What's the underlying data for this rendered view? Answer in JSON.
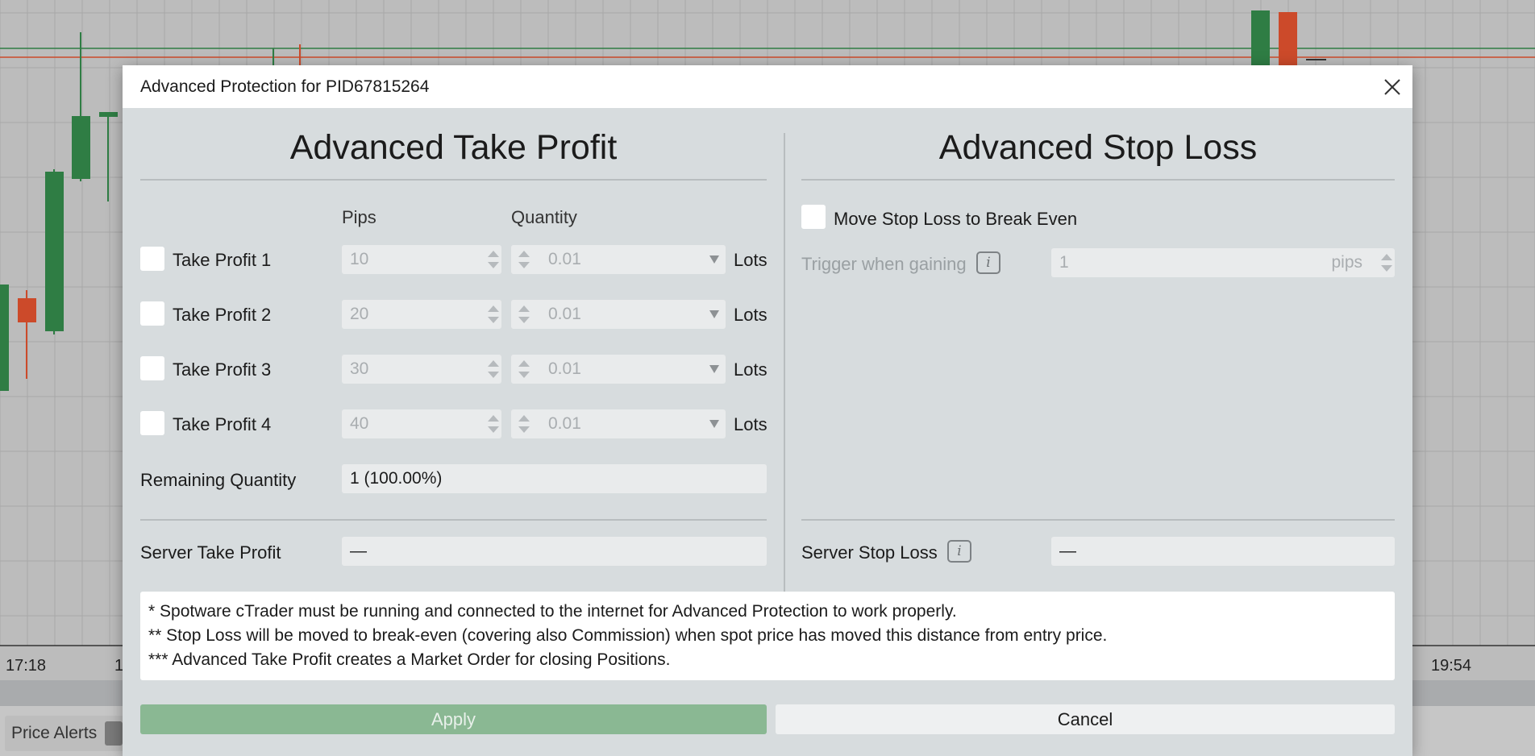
{
  "background": {
    "time_labels": [
      "17:18",
      "1",
      "19:54"
    ],
    "bottom_tab": {
      "label": "Price Alerts"
    },
    "colors": {
      "bull": "#2f7d44",
      "bear": "#cc4a2a",
      "grid": "#a8a8a8"
    }
  },
  "dialog": {
    "title": "Advanced Protection for PID67815264",
    "close_icon": "close-icon"
  },
  "take_profit": {
    "heading": "Advanced Take Profit",
    "pips_header": "Pips",
    "quantity_header": "Quantity",
    "rows": [
      {
        "label": "Take Profit 1",
        "pips": "10",
        "quantity": "0.01",
        "unit": "Lots",
        "checked": false
      },
      {
        "label": "Take Profit 2",
        "pips": "20",
        "quantity": "0.01",
        "unit": "Lots",
        "checked": false
      },
      {
        "label": "Take Profit 3",
        "pips": "30",
        "quantity": "0.01",
        "unit": "Lots",
        "checked": false
      },
      {
        "label": "Take Profit 4",
        "pips": "40",
        "quantity": "0.01",
        "unit": "Lots",
        "checked": false
      }
    ],
    "remaining_label": "Remaining Quantity",
    "remaining_value": "1 (100.00%)",
    "server_label": "Server Take Profit",
    "server_value": "—"
  },
  "stop_loss": {
    "heading": "Advanced Stop Loss",
    "break_even_label": "Move Stop Loss to Break Even",
    "break_even_checked": false,
    "trigger_label": "Trigger when gaining",
    "trigger_value": "1",
    "trigger_unit": "pips",
    "server_label": "Server Stop Loss",
    "server_value": "—"
  },
  "notes": [
    "* Spotware cTrader must be running and connected to the internet for Advanced Protection to work properly.",
    "** Stop Loss will be moved to break-even (covering also Commission) when spot price has moved this distance from entry price.",
    "*** Advanced Take Profit creates a Market Order for closing Positions."
  ],
  "buttons": {
    "apply": "Apply",
    "cancel": "Cancel"
  },
  "accent": {
    "apply_bg": "#8ab893"
  }
}
